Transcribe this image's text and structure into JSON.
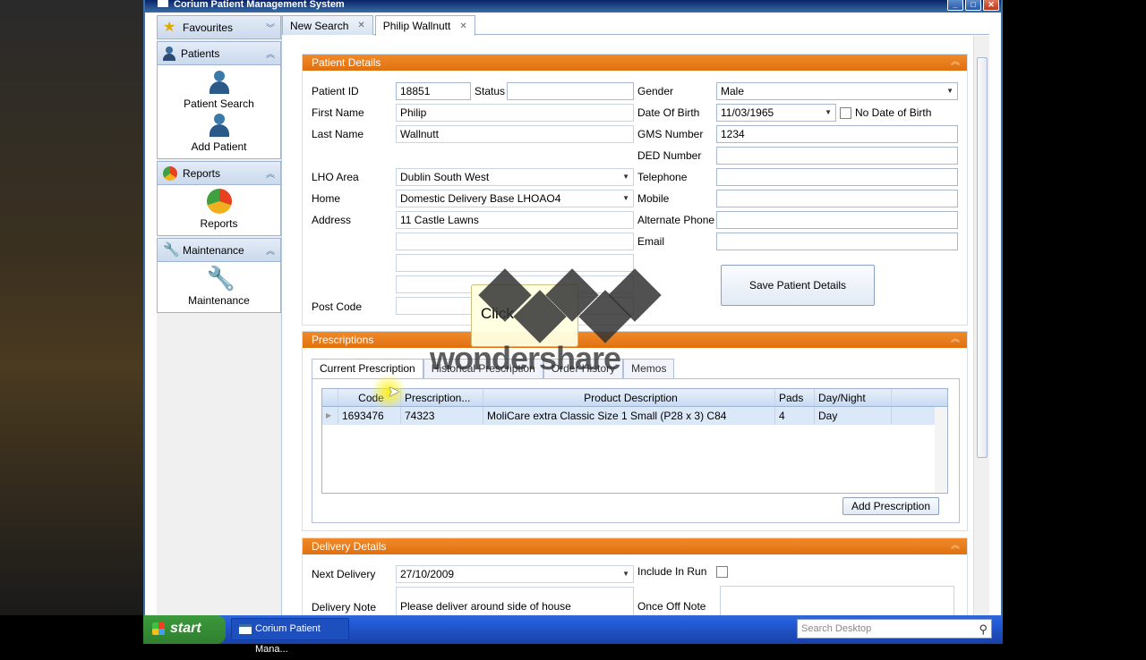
{
  "window": {
    "title": "Corium Patient Management System"
  },
  "sidebar": {
    "groups": [
      {
        "label": "Favourites",
        "icon": "star-icon",
        "items": []
      },
      {
        "label": "Patients",
        "icon": "person-icon",
        "items": [
          {
            "label": "Patient Search",
            "icon": "patient-search-icon"
          },
          {
            "label": "Add Patient",
            "icon": "add-patient-icon"
          }
        ]
      },
      {
        "label": "Reports",
        "icon": "pie-chart-icon",
        "items": [
          {
            "label": "Reports",
            "icon": "pie-chart-icon"
          }
        ]
      },
      {
        "label": "Maintenance",
        "icon": "wrench-icon",
        "items": [
          {
            "label": "Maintenance",
            "icon": "wrench-icon"
          }
        ]
      }
    ]
  },
  "tabs": [
    {
      "label": "New Search"
    },
    {
      "label": "Philip Wallnutt"
    }
  ],
  "patient": {
    "section_title": "Patient Details",
    "labels": {
      "patient_id": "Patient ID",
      "status": "Status",
      "first_name": "First Name",
      "last_name": "Last Name",
      "lho_area": "LHO Area",
      "home": "Home",
      "address": "Address",
      "post_code": "Post Code",
      "gender": "Gender",
      "dob": "Date Of Birth",
      "no_dob": "No Date of Birth",
      "gms": "GMS Number",
      "ded": "DED Number",
      "telephone": "Telephone",
      "mobile": "Mobile",
      "alt_phone": "Alternate Phone",
      "email": "Email"
    },
    "values": {
      "patient_id": "18851",
      "status": "",
      "first_name": "Philip",
      "last_name": "Wallnutt",
      "lho_area": "Dublin South West",
      "home": "Domestic Delivery Base LHOAO4",
      "address1": "11 Castle Lawns",
      "address2": "",
      "address3": "",
      "address4": "",
      "post_code": "",
      "gender": "Male",
      "dob": "11/03/1965",
      "gms": "1234",
      "ded": "",
      "telephone": "",
      "mobile": "",
      "alt_phone": "",
      "email": ""
    },
    "save_label": "Save Patient Details"
  },
  "prescriptions": {
    "section_title": "Prescriptions",
    "tabs": [
      "Current Prescription",
      "Historical Prescription",
      "Order History",
      "Memos"
    ],
    "columns": [
      "Code",
      "Prescription...",
      "Product Description",
      "Pads",
      "Day/Night"
    ],
    "rows": [
      [
        "1693476",
        "74323",
        "MoliCare extra Classic Size 1 Small  (P28 x 3) C84",
        "4",
        "Day"
      ]
    ],
    "add_label": "Add Prescription"
  },
  "delivery": {
    "section_title": "Delivery Details",
    "labels": {
      "next": "Next Delivery",
      "include": "Include In Run",
      "note": "Delivery Note",
      "once": "Once Off Note"
    },
    "values": {
      "next": "27/10/2009",
      "note": "Please deliver around side of house",
      "once": ""
    }
  },
  "overlay": {
    "callout": "Click",
    "watermark": "wondershare"
  },
  "taskbar": {
    "start": "start",
    "task": "Corium Patient Mana...",
    "search_placeholder": "Search Desktop"
  }
}
